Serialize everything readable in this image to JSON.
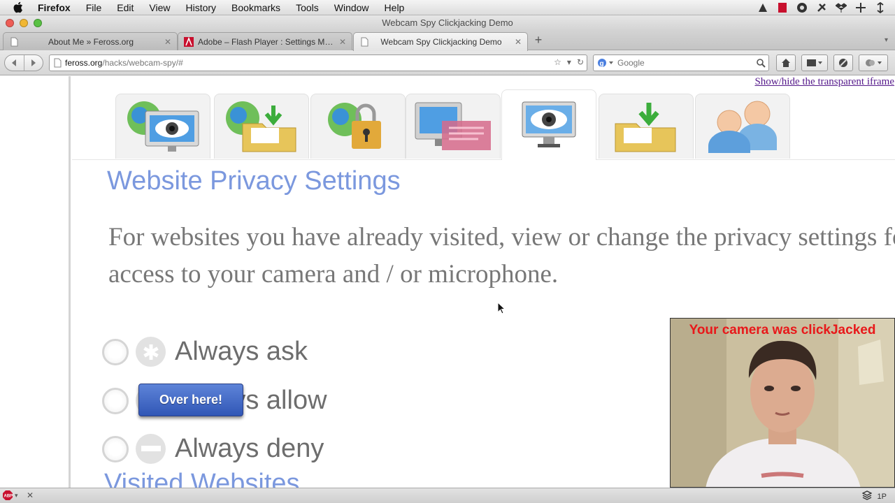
{
  "menubar": {
    "app": "Firefox",
    "items": [
      "File",
      "Edit",
      "View",
      "History",
      "Bookmarks",
      "Tools",
      "Window",
      "Help"
    ]
  },
  "window": {
    "title": "Webcam Spy Clickjacking Demo"
  },
  "tabs": [
    {
      "label": "About Me » Feross.org",
      "active": false
    },
    {
      "label": "Adobe – Flash Player : Settings Manager",
      "active": false
    },
    {
      "label": "Webcam Spy Clickjacking Demo",
      "active": true
    }
  ],
  "urlbar": {
    "host": "feross.org",
    "path": "/hacks/webcam-spy/#"
  },
  "search": {
    "placeholder": "Google"
  },
  "page": {
    "showhide_link": "Show/hide the transparent iframe",
    "heading": "Website Privacy Settings",
    "description": "For websites you have already visited, view or change the privacy settings for access to your camera and / or microphone.",
    "options": {
      "ask": "Always ask",
      "allow": "Always allow",
      "deny": "Always deny"
    },
    "over_button": "Over here!",
    "visited_heading": "Visited Websites",
    "camera_message": "Your camera was clickJacked"
  },
  "statusbar": {
    "right_text": "1P"
  },
  "colors": {
    "heading": "#7b98de",
    "camera_message": "#e8181a",
    "button": "#3f66c4",
    "link": "#551a8b"
  }
}
